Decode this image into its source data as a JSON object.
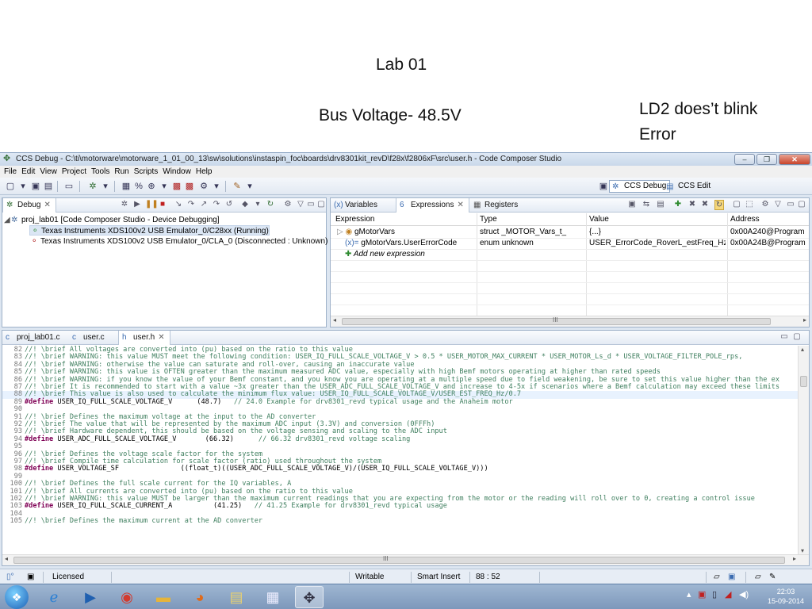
{
  "slide": {
    "title": "Lab 01",
    "bus_voltage": "Bus Voltage- 48.5V",
    "ld2_note": "LD2 does’t blink",
    "error_note": "Error"
  },
  "window": {
    "title": "CCS Debug - C:\\ti\\motorware\\motorware_1_01_00_13\\sw\\solutions\\instaspin_foc\\boards\\drv8301kit_revD\\f28x\\f2806xF\\src\\user.h - Code Composer Studio",
    "minimize": "–",
    "maximize": "❐",
    "close": "✕"
  },
  "menu": [
    "File",
    "Edit",
    "View",
    "Project",
    "Tools",
    "Run",
    "Scripts",
    "Window",
    "Help"
  ],
  "perspectives": {
    "active": "CCS Debug",
    "other": "CCS Edit"
  },
  "debug_view": {
    "tab": "Debug",
    "items": [
      {
        "label": "proj_lab01 [Code Composer Studio - Device Debugging]"
      },
      {
        "label": "Texas Instruments XDS100v2 USB Emulator_0/C28xx (Running)"
      },
      {
        "label": "Texas Instruments XDS100v2 USB Emulator_0/CLA_0 (Disconnected : Unknown)"
      }
    ]
  },
  "expressions_view": {
    "tabs": [
      "Variables",
      "Expressions",
      "Registers"
    ],
    "columns": [
      "Expression",
      "Type",
      "Value",
      "Address"
    ],
    "rows": [
      {
        "expression": "gMotorVars",
        "type": "struct _MOTOR_Vars_t_",
        "value": "{...}",
        "address": "0x00A240@Program"
      },
      {
        "expression": "gMotorVars.UserErrorCode",
        "type": "enum unknown",
        "value": "USER_ErrorCode_RoverL_estFreq_Hz_High",
        "address": "0x00A24B@Program"
      }
    ],
    "add_new": "Add new expression",
    "scroll_label": "III"
  },
  "editor": {
    "tabs": [
      "proj_lab01.c",
      "user.c",
      "user.h"
    ],
    "lines": [
      {
        "n": "82",
        "t": "//! \\brief All voltages are converted into (pu) based on the ratio to this value",
        "k": "cm"
      },
      {
        "n": "83",
        "t": "//! \\brief WARNING: this value MUST meet the following condition: USER_IQ_FULL_SCALE_VOLTAGE_V > 0.5 * USER_MOTOR_MAX_CURRENT * USER_MOTOR_Ls_d * USER_VOLTAGE_FILTER_POLE_rps,",
        "k": "cm"
      },
      {
        "n": "84",
        "t": "//! \\brief WARNING: otherwise the value can saturate and roll-over, causing an inaccurate value",
        "k": "cm"
      },
      {
        "n": "85",
        "t": "//! \\brief WARNING: this value is OFTEN greater than the maximum measured ADC value, especially with high Bemf motors operating at higher than rated speeds",
        "k": "cm"
      },
      {
        "n": "86",
        "t": "//! \\brief WARNING: if you know the value of your Bemf constant, and you know you are operating at a multiple speed due to field weakening, be sure to set this value higher than the ex",
        "k": "cm"
      },
      {
        "n": "87",
        "t": "//! \\brief It is recommended to start with a value ~3x greater than the USER_ADC_FULL_SCALE_VOLTAGE_V and increase to 4-5x if scenarios where a Bemf calculation may exceed these limits",
        "k": "cm"
      },
      {
        "n": "88",
        "t": "//! \\brief This value is also used to calculate the minimum flux value: USER_IQ_FULL_SCALE_VOLTAGE_V/USER_EST_FREQ_Hz/0.7",
        "k": "cm",
        "cur": true
      },
      {
        "n": "89",
        "d": "#define",
        "t": " USER_IQ_FULL_SCALE_VOLTAGE_V      (48.7)   ",
        "c": "// 24.0 Example for drv8301_revd typical usage and the Anaheim motor"
      },
      {
        "n": "90",
        "t": "",
        "k": ""
      },
      {
        "n": "91",
        "t": "//! \\brief Defines the maximum voltage at the input to the AD converter",
        "k": "cm"
      },
      {
        "n": "92",
        "t": "//! \\brief The value that will be represented by the maximum ADC input (3.3V) and conversion (0FFFh)",
        "k": "cm"
      },
      {
        "n": "93",
        "t": "//! \\brief Hardware dependent, this should be based on the voltage sensing and scaling to the ADC input",
        "k": "cm"
      },
      {
        "n": "94",
        "d": "#define",
        "t": " USER_ADC_FULL_SCALE_VOLTAGE_V       (66.32)      ",
        "c": "// 66.32 drv8301_revd voltage scaling"
      },
      {
        "n": "95",
        "t": "",
        "k": ""
      },
      {
        "n": "96",
        "t": "//! \\brief Defines the voltage scale factor for the system",
        "k": "cm"
      },
      {
        "n": "97",
        "t": "//! \\brief Compile time calculation for scale factor (ratio) used throughout the system",
        "k": "cm"
      },
      {
        "n": "98",
        "d": "#define",
        "t": " USER_VOLTAGE_SF               ((float_t)((USER_ADC_FULL_SCALE_VOLTAGE_V)/(USER_IQ_FULL_SCALE_VOLTAGE_V)))",
        "c": ""
      },
      {
        "n": "99",
        "t": "",
        "k": ""
      },
      {
        "n": "100",
        "t": "//! \\brief Defines the full scale current for the IQ variables, A",
        "k": "cm"
      },
      {
        "n": "101",
        "t": "//! \\brief All currents are converted into (pu) based on the ratio to this value",
        "k": "cm"
      },
      {
        "n": "102",
        "t": "//! \\brief WARNING: this value MUST be larger than the maximum current readings that you are expecting from the motor or the reading will roll over to 0, creating a control issue",
        "k": "cm"
      },
      {
        "n": "103",
        "d": "#define",
        "t": " USER_IQ_FULL_SCALE_CURRENT_A          (41.25)   ",
        "c": "// 41.25 Example for drv8301_revd typical usage"
      },
      {
        "n": "104",
        "t": "",
        "k": ""
      },
      {
        "n": "105",
        "t": "//! \\brief Defines the maximum current at the AD converter",
        "k": "cm"
      }
    ],
    "scroll_label": "III"
  },
  "status": {
    "licensed": "Licensed",
    "writable": "Writable",
    "insert_mode": "Smart Insert",
    "position": "88 : 52"
  },
  "taskbar": {
    "time": "22:03",
    "date": "15-09-2014"
  },
  "colors": {
    "comment": "#3f7f5f",
    "keyword": "#7f0055",
    "window_frame": "#dde6f1"
  }
}
